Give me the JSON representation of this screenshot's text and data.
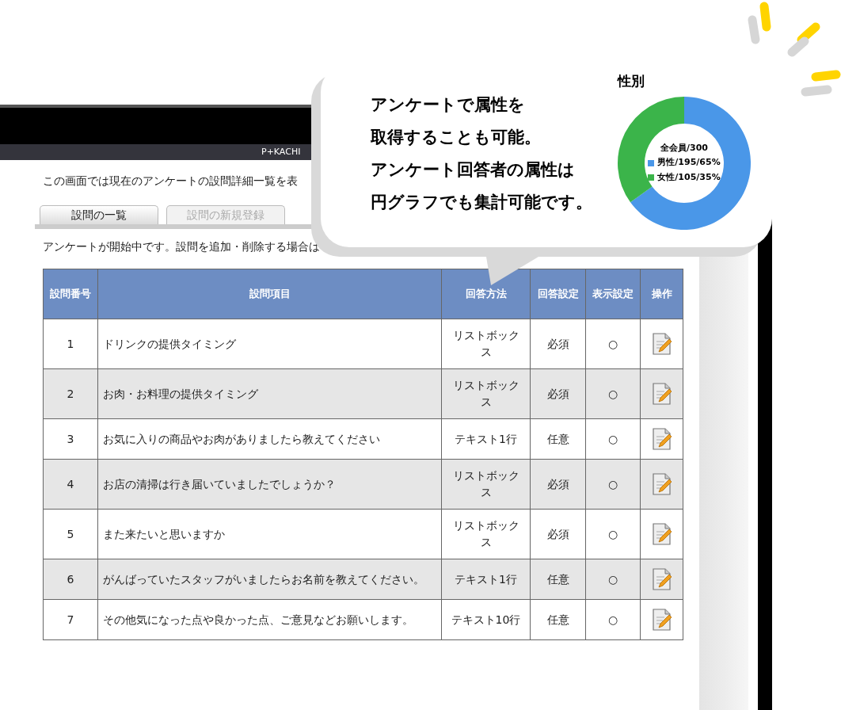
{
  "header": {
    "brand": "P+KACHI"
  },
  "intro": "この画面では現在のアンケートの設問詳細一覧を表",
  "tabs": [
    {
      "label": "設問の一覧",
      "selected": true
    },
    {
      "label": "設問の新規登録",
      "selected": false
    }
  ],
  "notice": "アンケートが開始中です。設問を追加・削除する場合は",
  "table": {
    "columns": [
      "設問番号",
      "設問項目",
      "回答方法",
      "回答設定",
      "表示設定",
      "操作"
    ],
    "rows": [
      {
        "number": "1",
        "question": "ドリンクの提供タイミング",
        "method": "リストボックス",
        "required": "必須",
        "display": "○"
      },
      {
        "number": "2",
        "question": "お肉・お料理の提供タイミング",
        "method": "リストボックス",
        "required": "必須",
        "display": "○"
      },
      {
        "number": "3",
        "question": "お気に入りの商品やお肉がありましたら教えてください",
        "method": "テキスト1行",
        "required": "任意",
        "display": "○"
      },
      {
        "number": "4",
        "question": "お店の清掃は行き届いていましたでしょうか？",
        "method": "リストボックス",
        "required": "必須",
        "display": "○"
      },
      {
        "number": "5",
        "question": "また来たいと思いますか",
        "method": "リストボックス",
        "required": "必須",
        "display": "○"
      },
      {
        "number": "6",
        "question": "がんばっていたスタッフがいましたらお名前を教えてください。",
        "method": "テキスト1行",
        "required": "任意",
        "display": "○"
      },
      {
        "number": "7",
        "question": "その他気になった点や良かった点、ご意見などお願いします。",
        "method": "テキスト10行",
        "required": "任意",
        "display": "○"
      }
    ]
  },
  "callout": {
    "lines": [
      "アンケートで属性を",
      "取得することも可能。",
      "アンケート回答者の属性は",
      "円グラフでも集計可能です。"
    ],
    "chart": {
      "total_label": "全会員/300",
      "legend": [
        {
          "color": "#4a97e8"
        },
        {
          "color": "#3bb44a"
        }
      ],
      "chart_data": {
        "type": "donut",
        "title": "性別",
        "categories": [
          "男性/195/65%",
          "女性/105/35%"
        ],
        "values": [
          65,
          35
        ],
        "legend": "center"
      }
    }
  }
}
